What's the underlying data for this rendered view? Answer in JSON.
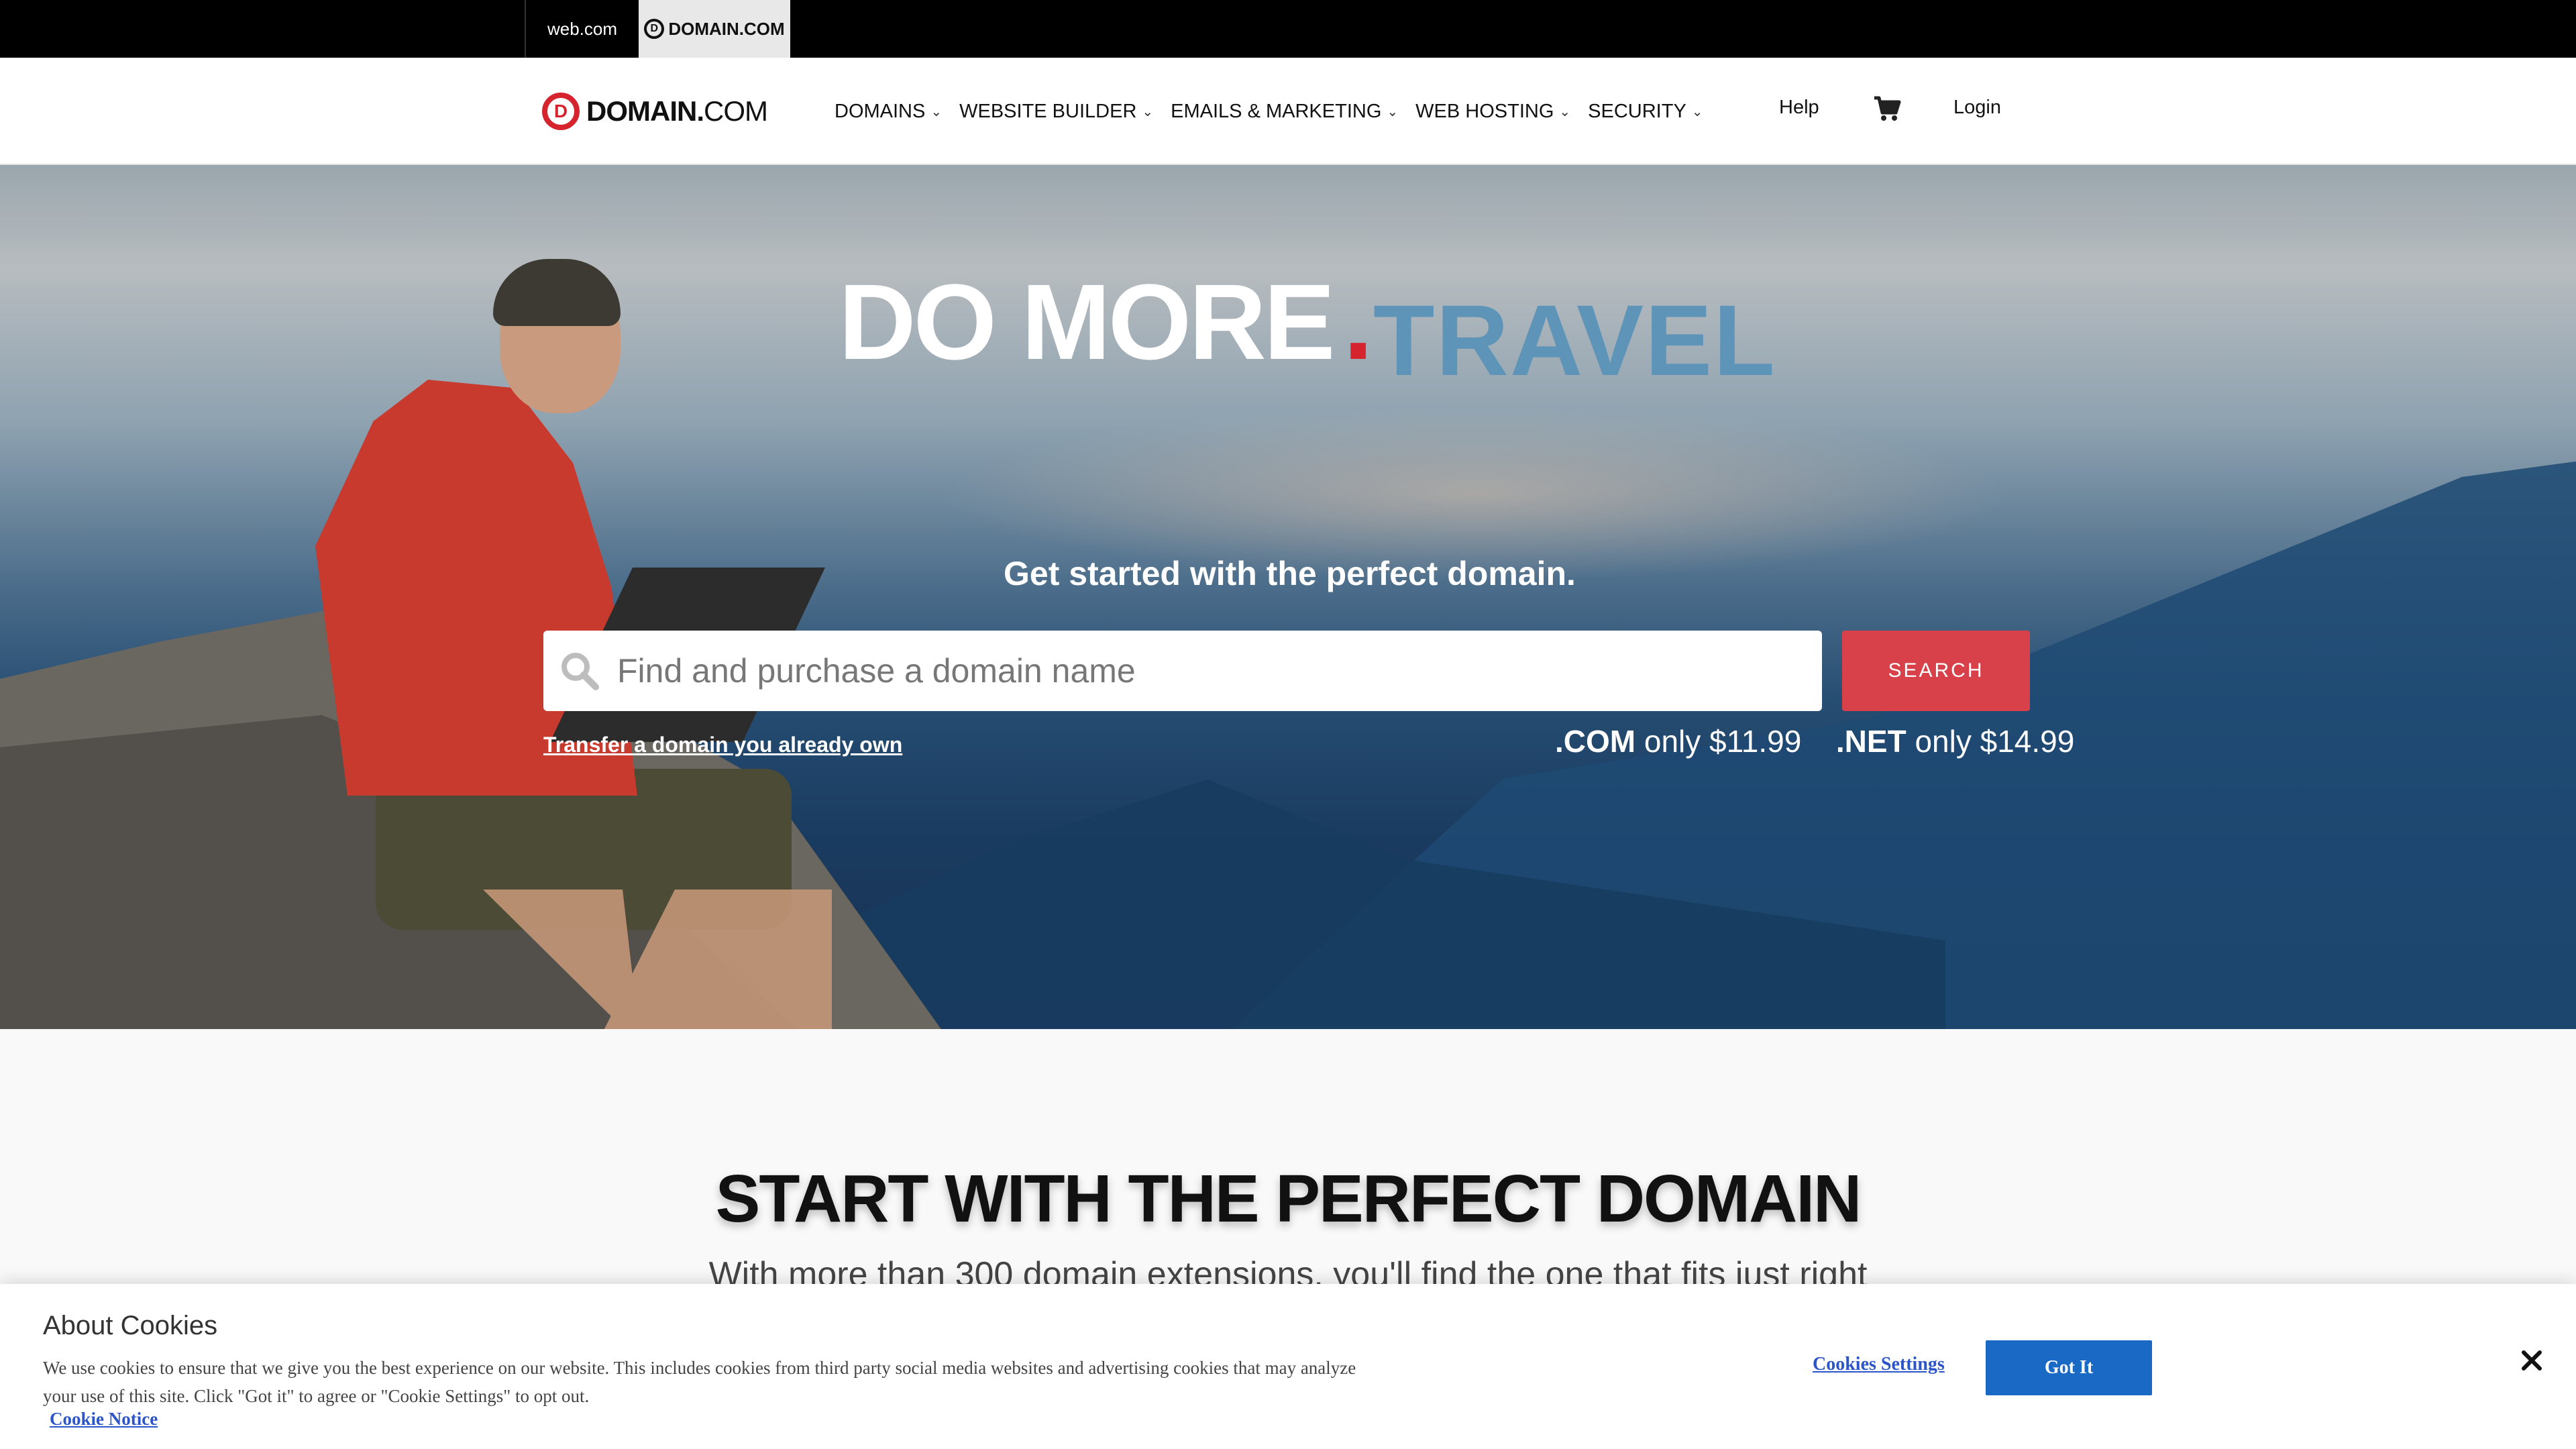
{
  "brand_bar": {
    "tabs": [
      {
        "label": "web.com"
      },
      {
        "label": "DOMAIN.COM"
      }
    ]
  },
  "header": {
    "logo": {
      "strong": "DOMAIN.",
      "light": "COM"
    },
    "nav": [
      {
        "label": "DOMAINS"
      },
      {
        "label": "WEBSITE BUILDER"
      },
      {
        "label": "EMAILS & MARKETING"
      },
      {
        "label": "WEB HOSTING"
      },
      {
        "label": "SECURITY"
      }
    ],
    "help": "Help",
    "login": "Login"
  },
  "hero": {
    "headline": "DO MORE",
    "dot": ".",
    "extension": "TRAVEL",
    "subheadline": "Get started with the perfect domain.",
    "search": {
      "placeholder": "Find and purchase a domain name",
      "button": "SEARCH"
    },
    "transfer_link": "Transfer a domain you already own",
    "prices": [
      {
        "tld": ".COM",
        "text": "only $11.99"
      },
      {
        "tld": ".NET",
        "text": "only $14.99"
      }
    ]
  },
  "section": {
    "title": "START WITH THE PERFECT DOMAIN",
    "subtitle": "With more than 300 domain extensions, you'll find the one that fits just right"
  },
  "cookie_banner": {
    "title": "About Cookies",
    "text": "We use cookies to ensure that we give you the best experience on our website. This includes cookies from third party social media websites and advertising cookies that may analyze your use of this site. Click \"Got it\" to agree or \"Cookie Settings\" to opt out.",
    "notice_link": "Cookie Notice",
    "settings_button": "Cookies Settings",
    "accept_button": "Got It"
  },
  "icons": {
    "cart": "cart-icon",
    "search": "search-icon",
    "close": "close-icon",
    "chevron": "chevron-down-icon"
  },
  "colors": {
    "brand_red": "#d6242f",
    "search_button": "#d9414a",
    "extension_blue": "#5d94b8",
    "cookie_button": "#1a69c4",
    "link_blue": "#2b55c9"
  }
}
